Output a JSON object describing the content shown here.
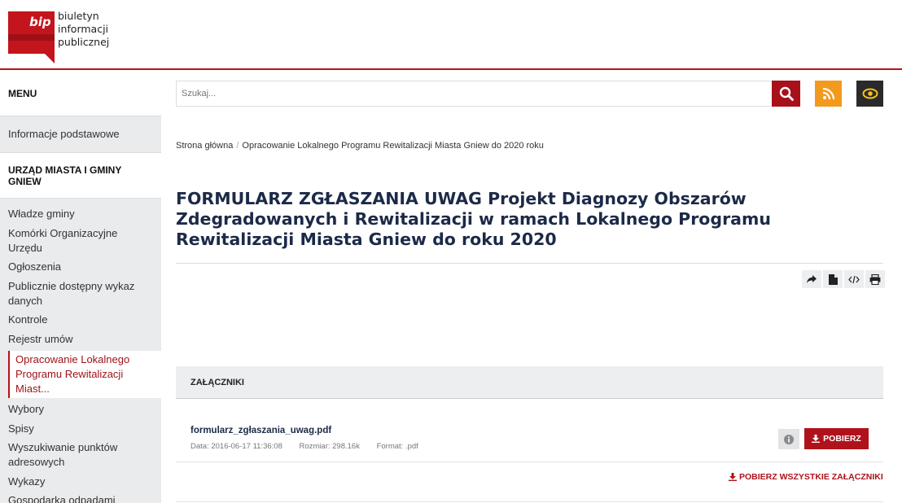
{
  "logo": {
    "mark": "bip",
    "line1": "biuletyn",
    "line2": "informacji publicznej"
  },
  "search": {
    "placeholder": "Szukaj..."
  },
  "icons": {
    "search": "search-icon",
    "rss": "rss-icon",
    "accessibility": "eye-icon",
    "share": "share-icon",
    "pdf": "document-icon",
    "embed": "code-icon",
    "print": "print-icon",
    "info": "info-icon",
    "download": "download-icon"
  },
  "colors": {
    "brand_red": "#b0121b",
    "rss_orange": "#f39a1e",
    "title_navy": "#1c2a48",
    "sidebar_bg": "#e9ebec"
  },
  "sidebar": {
    "menu_label": "MENU",
    "basic_info": "Informacje podstawowe",
    "section_title": "URZĄD MIASTA I GMINY GNIEW",
    "items_before": [
      "Władze gminy",
      "Komórki Organizacyjne Urzędu",
      "Ogłoszenia",
      "Publicznie dostępny wykaz danych",
      "Kontrole",
      "Rejestr umów"
    ],
    "active_item": "Opracowanie Lokalnego Programu Rewitalizacji Miast...",
    "items_after": [
      "Wybory",
      "Spisy",
      "Wyszukiwanie punktów adresowych",
      "Wykazy",
      "Gospodarka odpadami"
    ]
  },
  "breadcrumb": {
    "home": "Strona główna",
    "separator": "/",
    "current": "Opracowanie Lokalnego Programu Rewitalizacji Miasta Gniew do 2020 roku"
  },
  "page": {
    "title": "FORMULARZ ZGŁASZANIA UWAG Projekt Diagnozy Obszarów Zdegradowanych i Rewitalizacji w ramach Lokalnego Programu Rewitalizacji Miasta Gniew do roku 2020"
  },
  "attachments": {
    "heading": "ZAŁĄCZNIKI",
    "file": {
      "name": "formularz_zgłaszania_uwag.pdf",
      "date": "Data: 2016-06-17 11:36:08",
      "size": "Rozmiar: 298.16k",
      "format": "Format: .pdf"
    },
    "download_label": "POBIERZ",
    "download_all_label": "POBIERZ WSZYSTKIE ZAŁĄCZNIKI"
  }
}
